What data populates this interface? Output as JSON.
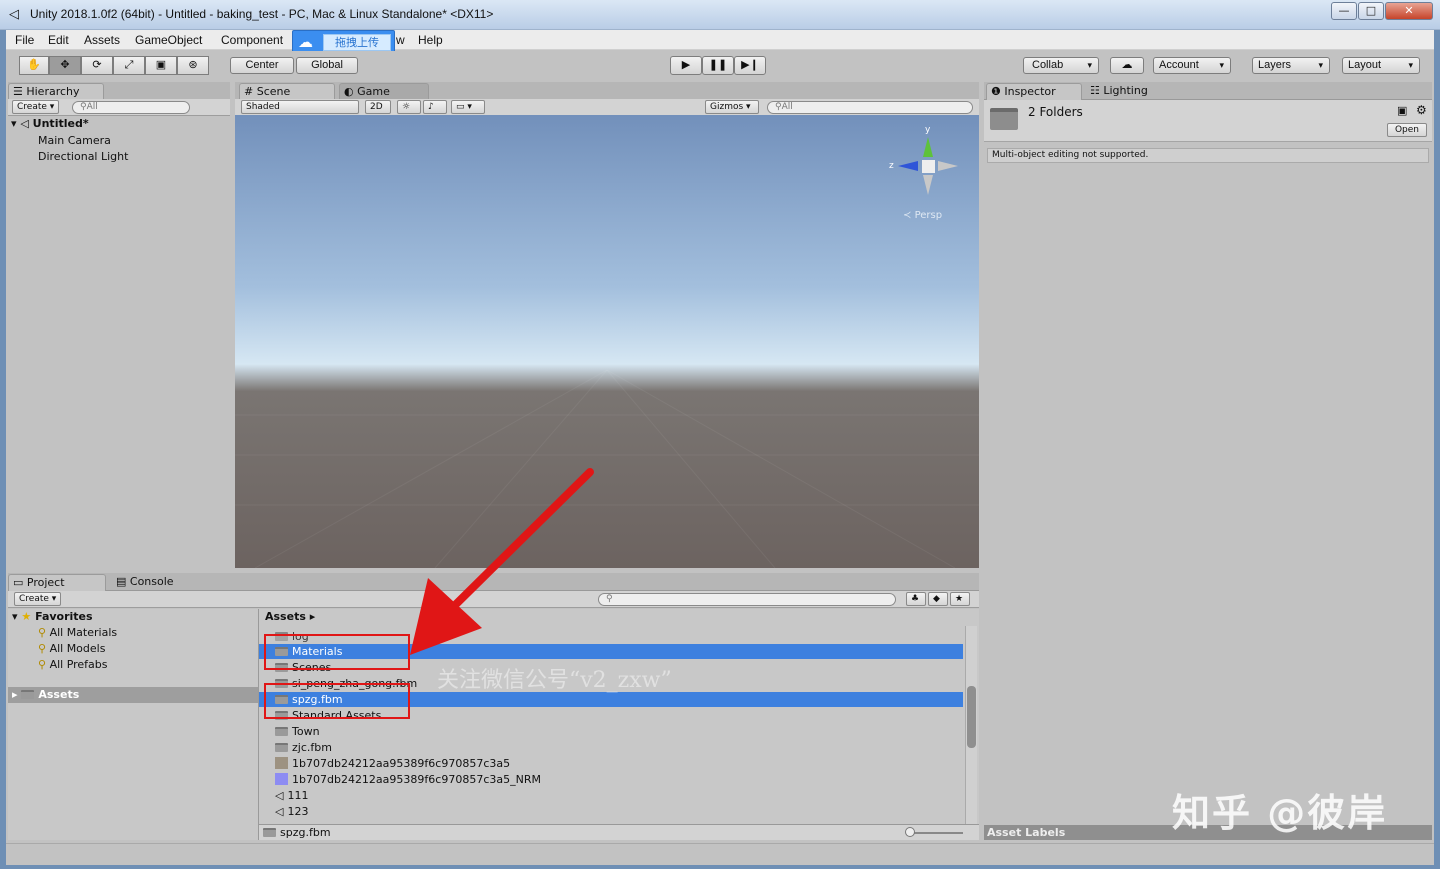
{
  "window": {
    "title": "Unity 2018.1.0f2 (64bit) - Untitled - baking_test - PC, Mac & Linux Standalone* <DX11>",
    "minimize": "—",
    "maximize": "□",
    "close": "✕"
  },
  "menu": [
    "File",
    "Edit",
    "Assets",
    "GameObject",
    "Component",
    "w",
    "Help"
  ],
  "upload_overlay": {
    "label": "拖拽上传"
  },
  "toolbar": {
    "center": "Center",
    "global": "Global",
    "collab": "Collab",
    "account": "Account",
    "layers": "Layers",
    "layout": "Layout"
  },
  "hierarchy": {
    "tab": "Hierarchy",
    "create": "Create",
    "search_placeholder": "All",
    "scene_name": "Untitled*",
    "items": [
      "Main Camera",
      "Directional Light"
    ]
  },
  "scene_view": {
    "tab_scene": "Scene",
    "tab_game": "Game",
    "shading": "Shaded",
    "mode_2d": "2D",
    "gizmos": "Gizmos",
    "search_placeholder": "All",
    "axis_y": "y",
    "axis_z": "z",
    "persp": "Persp"
  },
  "inspector": {
    "tab_inspector": "Inspector",
    "tab_lighting": "Lighting",
    "heading": "2 Folders",
    "open_button": "Open",
    "message": "Multi-object editing not supported.",
    "asset_labels": "Asset Labels"
  },
  "project": {
    "tab_project": "Project",
    "tab_console": "Console",
    "create": "Create",
    "favorites_label": "Favorites",
    "favorites": [
      "All Materials",
      "All Models",
      "All Prefabs"
    ],
    "assets_root": "Assets",
    "breadcrumb": "Assets",
    "files": [
      {
        "name": "log",
        "kind": "folder",
        "selected": false
      },
      {
        "name": "Materials",
        "kind": "folder",
        "selected": true
      },
      {
        "name": "Scenes",
        "kind": "folder",
        "selected": false
      },
      {
        "name": "si_peng_zha_gong.fbm",
        "kind": "folder",
        "selected": false
      },
      {
        "name": "spzg.fbm",
        "kind": "folder",
        "selected": true
      },
      {
        "name": "Standard Assets",
        "kind": "folder",
        "selected": false
      },
      {
        "name": "Town",
        "kind": "folder",
        "selected": false
      },
      {
        "name": "zjc.fbm",
        "kind": "folder",
        "selected": false
      },
      {
        "name": "1b707db24212aa95389f6c970857c3a5",
        "kind": "texture",
        "selected": false
      },
      {
        "name": "1b707db24212aa95389f6c970857c3a5_NRM",
        "kind": "normal",
        "selected": false
      },
      {
        "name": "111",
        "kind": "unity",
        "selected": false
      },
      {
        "name": "123",
        "kind": "unity",
        "selected": false
      }
    ],
    "footer_path": "spzg.fbm"
  },
  "watermarks": {
    "wechat": "关注微信公号“v2_zxw”",
    "zhihu": "知乎 @彼岸"
  },
  "colors": {
    "selection": "#3d80df",
    "annotation_red": "#e01616"
  }
}
